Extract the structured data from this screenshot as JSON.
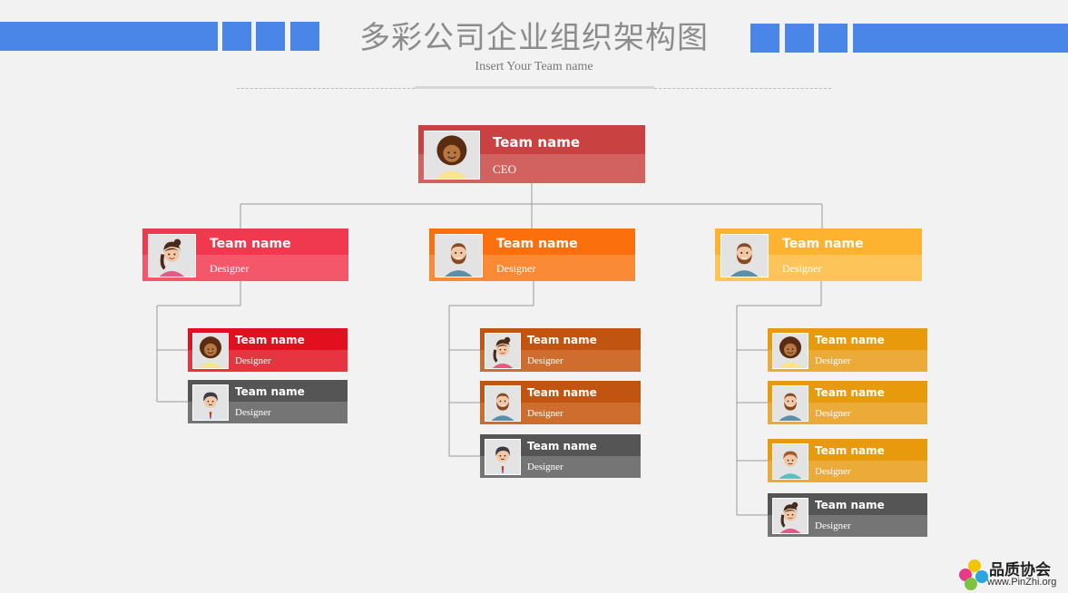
{
  "header": {
    "title": "多彩公司企业组织架构图",
    "subtitle": "Insert Your Team name"
  },
  "colors": {
    "accent_blue": "#4a86e8",
    "red": "#c23b3b",
    "pink": "#f0394f",
    "orange": "#f97316",
    "amber": "#fbb431",
    "gray": "#5b5b5b"
  },
  "ceo": {
    "name": "Team name",
    "role": "CEO",
    "avatar": "curly-hair-woman-avatar",
    "color": "#c94141",
    "color2": "#d2625f"
  },
  "managers": [
    {
      "name": "Team name",
      "role": "Designer",
      "avatar": "ponytail-woman-avatar",
      "color": "#f0394f",
      "color2": "#f4566a"
    },
    {
      "name": "Team name",
      "role": "Designer",
      "avatar": "bearded-man-avatar",
      "color": "#fb6f0d",
      "color2": "#fb8a37"
    },
    {
      "name": "Team name",
      "role": "Designer",
      "avatar": "bearded-man-avatar",
      "color": "#fdb330",
      "color2": "#fdc45a"
    }
  ],
  "teams": [
    [
      {
        "name": "Team name",
        "role": "Designer",
        "avatar": "curly-hair-woman-avatar",
        "color": "#e20f1e",
        "color2": "#e73441"
      },
      {
        "name": "Team name",
        "role": "Designer",
        "avatar": "short-hair-man-avatar",
        "color": "#555555",
        "color2": "#757575"
      }
    ],
    [
      {
        "name": "Team name",
        "role": "Designer",
        "avatar": "ponytail-woman-avatar",
        "color": "#c15410",
        "color2": "#cf6d2f"
      },
      {
        "name": "Team name",
        "role": "Designer",
        "avatar": "bearded-man-avatar",
        "color": "#c15410",
        "color2": "#cf6d2f"
      },
      {
        "name": "Team name",
        "role": "Designer",
        "avatar": "short-hair-man-avatar",
        "color": "#555555",
        "color2": "#757575"
      }
    ],
    [
      {
        "name": "Team name",
        "role": "Designer",
        "avatar": "curly-hair-woman-avatar",
        "color": "#e89a0d",
        "color2": "#ecab38"
      },
      {
        "name": "Team name",
        "role": "Designer",
        "avatar": "bearded-man-avatar",
        "color": "#e89a0d",
        "color2": "#ecab38"
      },
      {
        "name": "Team name",
        "role": "Designer",
        "avatar": "brown-hair-man-avatar",
        "color": "#e89a0d",
        "color2": "#ecab38"
      },
      {
        "name": "Team name",
        "role": "Designer",
        "avatar": "ponytail-woman-avatar",
        "color": "#555555",
        "color2": "#757575"
      }
    ]
  ],
  "watermark": {
    "brand": "品质协会",
    "url": "www.PinZhi.org",
    "logo": "pinwheel-logo"
  }
}
